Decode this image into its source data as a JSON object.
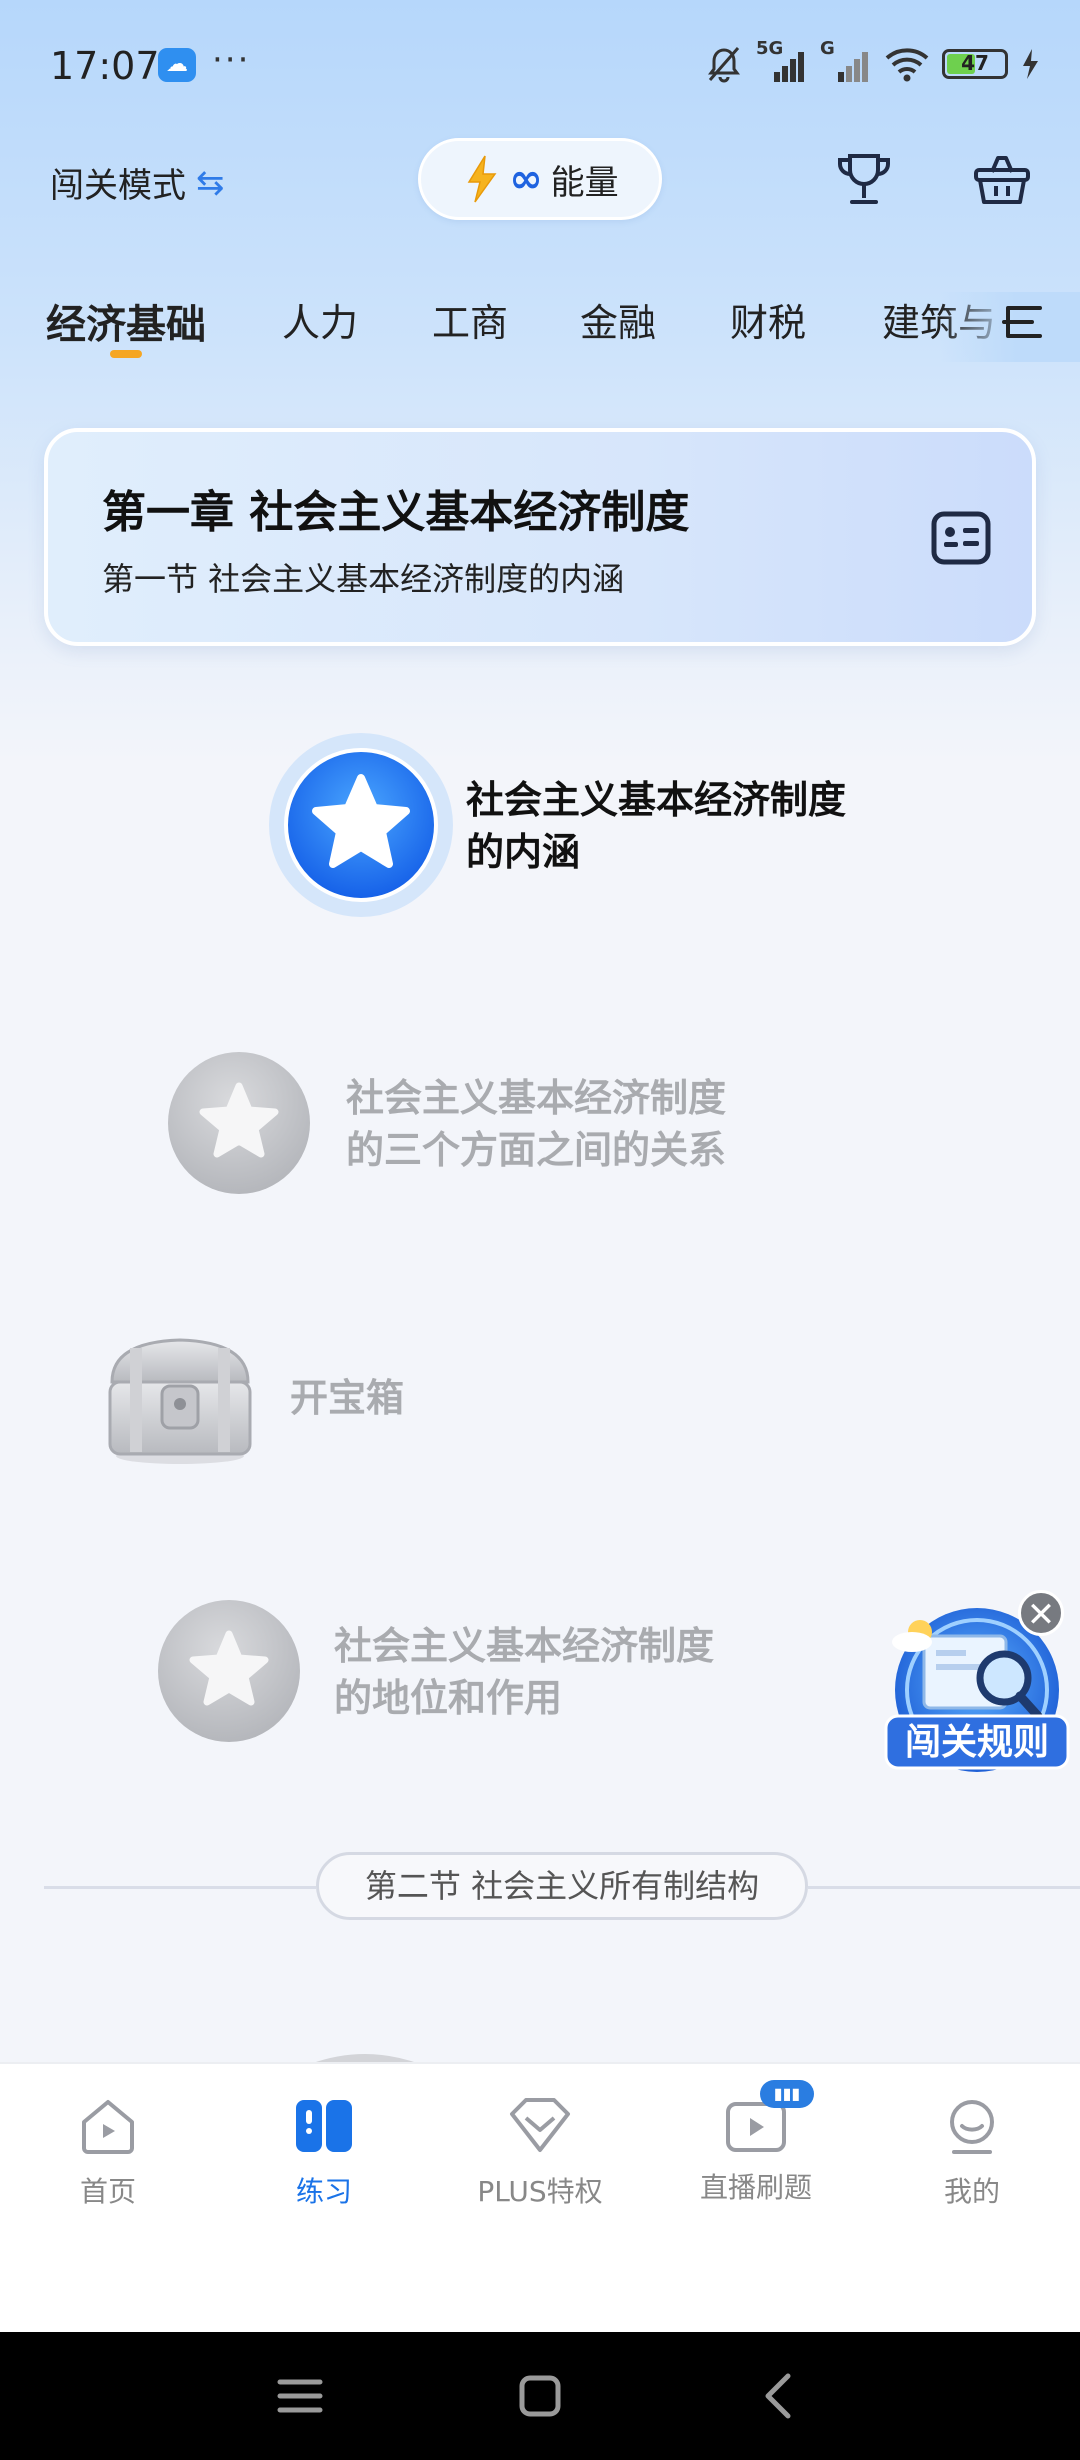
{
  "status_bar": {
    "time": "17:07",
    "more": "···",
    "signal_5g": "5G",
    "signal_g": "G",
    "battery": "47"
  },
  "header": {
    "mode_label": "闯关模式",
    "mode_swap_icon": "⇆",
    "energy_infinity": "∞",
    "energy_label": "能量"
  },
  "tabs": [
    {
      "label": "经济基础"
    },
    {
      "label": "人力"
    },
    {
      "label": "工商"
    },
    {
      "label": "金融"
    },
    {
      "label": "财税"
    },
    {
      "label": "建筑与"
    }
  ],
  "chapter": {
    "title": "第一章 社会主义基本经济制度",
    "subtitle": "第一节 社会主义基本经济制度的内涵"
  },
  "path": {
    "node1": {
      "line1": "社会主义基本经济制度",
      "line2": "的内涵"
    },
    "node2": {
      "line1": "社会主义基本经济制度",
      "line2": "的三个方面之间的关系"
    },
    "chest": {
      "label": "开宝箱"
    },
    "node3": {
      "line1": "社会主义基本经济制度",
      "line2": "的地位和作用"
    }
  },
  "section2": {
    "label": "第二节 社会主义所有制结构"
  },
  "rules_float": {
    "label": "闯关规则",
    "close": "✕"
  },
  "bottom_nav": [
    {
      "label": "首页"
    },
    {
      "label": "练习"
    },
    {
      "label": "PLUS特权"
    },
    {
      "label": "直播刷题"
    },
    {
      "label": "我的"
    }
  ],
  "colors": {
    "accent_blue": "#1a73e8",
    "tab_indicator": "#f5a623",
    "locked_text": "#a9abaf"
  }
}
